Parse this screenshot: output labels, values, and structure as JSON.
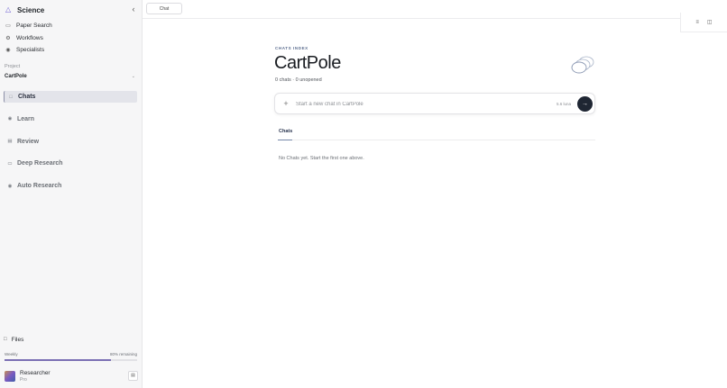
{
  "sidebar": {
    "app_title": "Science",
    "top_nav": [
      {
        "label": "Paper Search",
        "icon": "document-icon"
      },
      {
        "label": "Workflows",
        "icon": "gear-icon"
      },
      {
        "label": "Specialists",
        "icon": "eye-icon"
      }
    ],
    "project_label": "Project",
    "project_name": "CartPole",
    "main_nav": [
      {
        "label": "Chats",
        "icon": "chat-bubble-icon",
        "active": true
      },
      {
        "label": "Learn",
        "icon": "eye-icon",
        "active": false
      },
      {
        "label": "Review",
        "icon": "list-icon",
        "active": false
      },
      {
        "label": "Deep Research",
        "icon": "document-icon",
        "active": false
      },
      {
        "label": "Auto Research",
        "icon": "eye-icon",
        "active": false
      }
    ],
    "files_label": "Files",
    "usage": {
      "label": "Weekly",
      "remaining_text": "80% remaining",
      "fraction": 0.8
    },
    "user": {
      "name": "Researcher",
      "plan": "Pro"
    }
  },
  "topbar": {
    "tab_label": "Chat"
  },
  "main": {
    "eyebrow": "CHATS INDEX",
    "title": "CartPole",
    "stats": "0 chats · 0 unopened",
    "composer": {
      "placeholder": "Start a new chat in CartPole",
      "model_label": "5.6 luna"
    },
    "tabs": [
      {
        "label": "Chats"
      }
    ],
    "empty_message": "No Chats yet. Start the first one above."
  },
  "colors": {
    "accent": "#6d5fd3",
    "active_nav_bg": "#e3e4ea",
    "send_button": "#1f2633",
    "eyebrow": "#5c6e90"
  }
}
